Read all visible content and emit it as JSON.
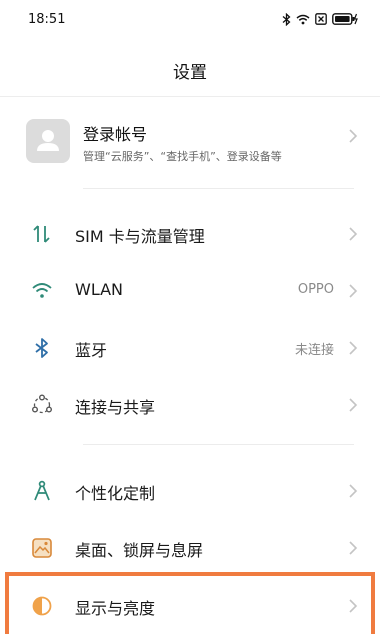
{
  "status_bar": {
    "time": "18:51"
  },
  "header": {
    "title": "设置"
  },
  "account": {
    "name": "登录帐号",
    "desc": "管理“云服务”、“查找手机”、登录设备等"
  },
  "items": [
    {
      "label": "SIM 卡与流量管理",
      "icon": "sim-data-icon"
    },
    {
      "label": "WLAN",
      "value": "OPPO",
      "icon": "wifi-icon"
    },
    {
      "label": "蓝牙",
      "value": "未连接",
      "icon": "bluetooth-icon"
    },
    {
      "label": "连接与共享",
      "icon": "connection-share-icon"
    },
    {
      "label": "个性化定制",
      "icon": "personalization-icon"
    },
    {
      "label": "桌面、锁屏与息屏",
      "icon": "wallpaper-icon"
    },
    {
      "label": "显示与亮度",
      "icon": "display-brightness-icon"
    }
  ],
  "colors": {
    "accent": "#2f8a78",
    "highlight": "#f07b3f",
    "display_icon": "#f0a24a"
  }
}
